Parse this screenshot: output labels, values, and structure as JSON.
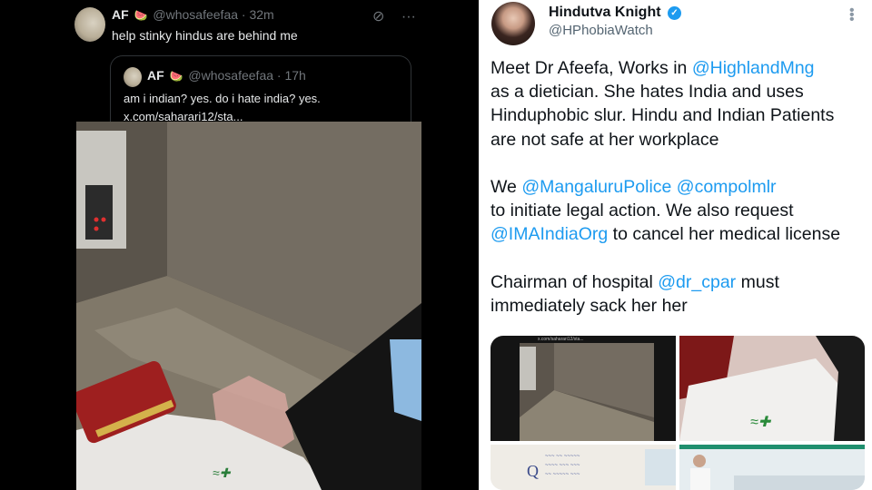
{
  "left_tweet": {
    "name": "AF",
    "emoji": "🍉",
    "handle": "@whosafeefaa",
    "time": "· 32m",
    "text": "help stinky hindus are behind me",
    "icons": [
      "grok-icon",
      "more-icon"
    ],
    "quoted": {
      "name": "AF",
      "emoji": "🍉",
      "handle": "@whosafeefaa",
      "time": "· 17h",
      "line1": "am i indian? yes. do i hate india? yes.",
      "line2": "x.com/saharari12/sta..."
    }
  },
  "right_tweet": {
    "name": "Hindutva Knight",
    "handle": "@HPhobiaWatch",
    "verified": true,
    "para1": {
      "l1_pre": "Meet Dr Afeefa, Works in ",
      "l1_mention": "@HighlandMng",
      "l2": "as a dietician. She hates India and uses",
      "l3": "Hinduphobic slur. Hindu and Indian Patients",
      "l4": "are not safe at her workplace"
    },
    "para2": {
      "l1_pre": "We ",
      "l1_mention1": "@MangaluruPolice",
      "l1_space": " ",
      "l1_mention2": "@compolmlr",
      "l2": "to initiate legal action. We also request",
      "l3_mention": "@IMAIndiaOrg",
      "l3_post": " to cancel her medical license"
    },
    "para3": {
      "l1_pre": "Chairman of hospital ",
      "l1_mention": "@dr_cpar",
      "l1_post": " must",
      "l2": "immediately sack her her"
    },
    "media_url_text": "x.com/saharari12/sta...",
    "accent_color": "#1d9bf0"
  }
}
